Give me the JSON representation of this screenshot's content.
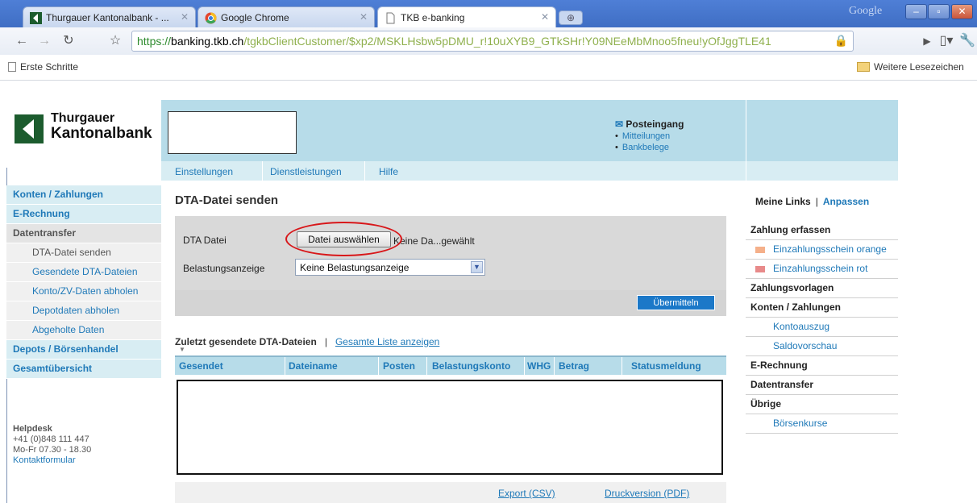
{
  "browser": {
    "tabs": [
      {
        "title": "Thurgauer Kantonalbank - ...",
        "icon": "tkb-logo-icon"
      },
      {
        "title": "Google Chrome",
        "icon": "chrome-icon"
      },
      {
        "title": "TKB e-banking",
        "icon": "page-icon"
      }
    ],
    "google_label": "Google",
    "url": {
      "scheme": "https://",
      "host": "banking.tkb.ch",
      "path": "/tgkbClientCustomer/$xp2/MSKLHsbw5pDMU_r!10uXYB9_GTkSHr!Y09NEeMbMnoo5fneu!yOfJggTLE41"
    },
    "bookmarks": {
      "left": "Erste Schritte",
      "right": "Weitere Lesezeichen"
    },
    "colors": {
      "titlebar": "#4a7bd4",
      "https": "#2c8a2c"
    }
  },
  "site": {
    "logo": {
      "line1": "Thurgauer",
      "line2": "Kantonalbank"
    },
    "inbox": {
      "title": "Posteingang",
      "items": [
        "Mitteilungen",
        "Bankbelege"
      ]
    },
    "top_nav": [
      "Einstellungen",
      "Dienstleistungen",
      "Hilfe"
    ],
    "sidebar": [
      {
        "label": "Konten / Zahlungen",
        "level": "main"
      },
      {
        "label": "E-Rechnung",
        "level": "main"
      },
      {
        "label": "Datentransfer",
        "level": "main2"
      },
      {
        "label": "DTA-Datei senden",
        "level": "sub-current"
      },
      {
        "label": "Gesendete DTA-Dateien",
        "level": "sub"
      },
      {
        "label": "Konto/ZV-Daten abholen",
        "level": "sub"
      },
      {
        "label": "Depotdaten abholen",
        "level": "sub"
      },
      {
        "label": "Abgeholte Daten",
        "level": "sub"
      },
      {
        "label": "Depots / Börsenhandel",
        "level": "main"
      },
      {
        "label": "Gesamtübersicht",
        "level": "main"
      }
    ],
    "helpdesk": {
      "title": "Helpdesk",
      "phone": "+41 (0)848 111 447",
      "hours": "Mo-Fr 07.30 - 18.30",
      "link": "Kontaktformular"
    },
    "main": {
      "title": "DTA-Datei senden",
      "dta_label": "DTA Datei",
      "file_button": "Datei auswählen",
      "file_status": "Keine Da...gewählt",
      "debit_label": "Belastungsanzeige",
      "debit_selected": "Keine Belastungsanzeige",
      "submit": "Übermitteln",
      "recent_title": "Zuletzt gesendete DTA-Dateien",
      "recent_sep": "|",
      "recent_link": "Gesamte Liste anzeigen",
      "columns": [
        "Gesendet",
        "Dateiname",
        "Posten",
        "Belastungskonto",
        "WHG",
        "Betrag",
        "Statusmeldung"
      ],
      "export_csv": "Export (CSV)",
      "print_pdf": "Druckversion (PDF)"
    },
    "right": {
      "header": "Meine Links",
      "header_sep": "|",
      "customize": "Anpassen",
      "items": [
        {
          "label": "Zahlung erfassen",
          "type": "bold"
        },
        {
          "label": "Einzahlungsschein orange",
          "type": "square",
          "color": "#f5b08a"
        },
        {
          "label": "Einzahlungsschein rot",
          "type": "square",
          "color": "#e88a8a"
        },
        {
          "label": "Zahlungsvorlagen",
          "type": "bold"
        },
        {
          "label": "Konten / Zahlungen",
          "type": "bold"
        },
        {
          "label": "Kontoauszug",
          "type": "sub"
        },
        {
          "label": "Saldovorschau",
          "type": "sub"
        },
        {
          "label": "E-Rechnung",
          "type": "bold"
        },
        {
          "label": "Datentransfer",
          "type": "bold"
        },
        {
          "label": "Übrige",
          "type": "bold"
        },
        {
          "label": "Börsenkurse",
          "type": "sub"
        }
      ]
    },
    "colors": {
      "accent_blue": "#1f79b8",
      "banner": "#b7dce9",
      "button_blue": "#1b78c8",
      "highlight_red": "#d8171a"
    }
  }
}
